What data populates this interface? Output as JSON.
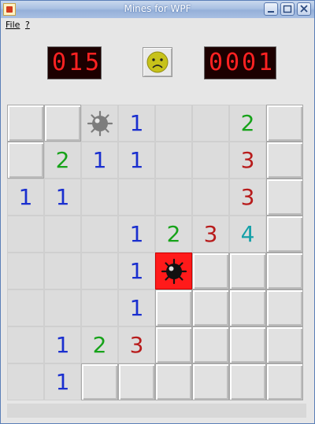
{
  "window": {
    "title": "Mines for WPF"
  },
  "menu": {
    "file": "File",
    "help": "?"
  },
  "counters": {
    "mines": [
      "0",
      "1",
      "5"
    ],
    "time": [
      "0",
      "0",
      "0",
      "1"
    ]
  },
  "face": {
    "state": "sad"
  },
  "colors": {
    "1": "#1a2fcf",
    "2": "#17a31a",
    "3": "#b81c1c",
    "4": "#14a0a8"
  },
  "board": {
    "cols": 8,
    "rows": 8,
    "cells": [
      [
        "C",
        "C",
        "M",
        "1",
        "O",
        "O",
        "2",
        "C"
      ],
      [
        "C",
        "2",
        "1",
        "1",
        "O",
        "O",
        "3",
        "C"
      ],
      [
        "1",
        "1",
        "O",
        "O",
        "O",
        "O",
        "3",
        "C"
      ],
      [
        "O",
        "O",
        "O",
        "1",
        "2",
        "3",
        "4",
        "C"
      ],
      [
        "O",
        "O",
        "O",
        "1",
        "X",
        "C",
        "C",
        "C"
      ],
      [
        "O",
        "O",
        "O",
        "1",
        "C",
        "C",
        "C",
        "C"
      ],
      [
        "O",
        "1",
        "2",
        "3",
        "C",
        "C",
        "C",
        "C"
      ],
      [
        "O",
        "1",
        "C",
        "C",
        "C",
        "C",
        "C",
        "C"
      ]
    ]
  }
}
